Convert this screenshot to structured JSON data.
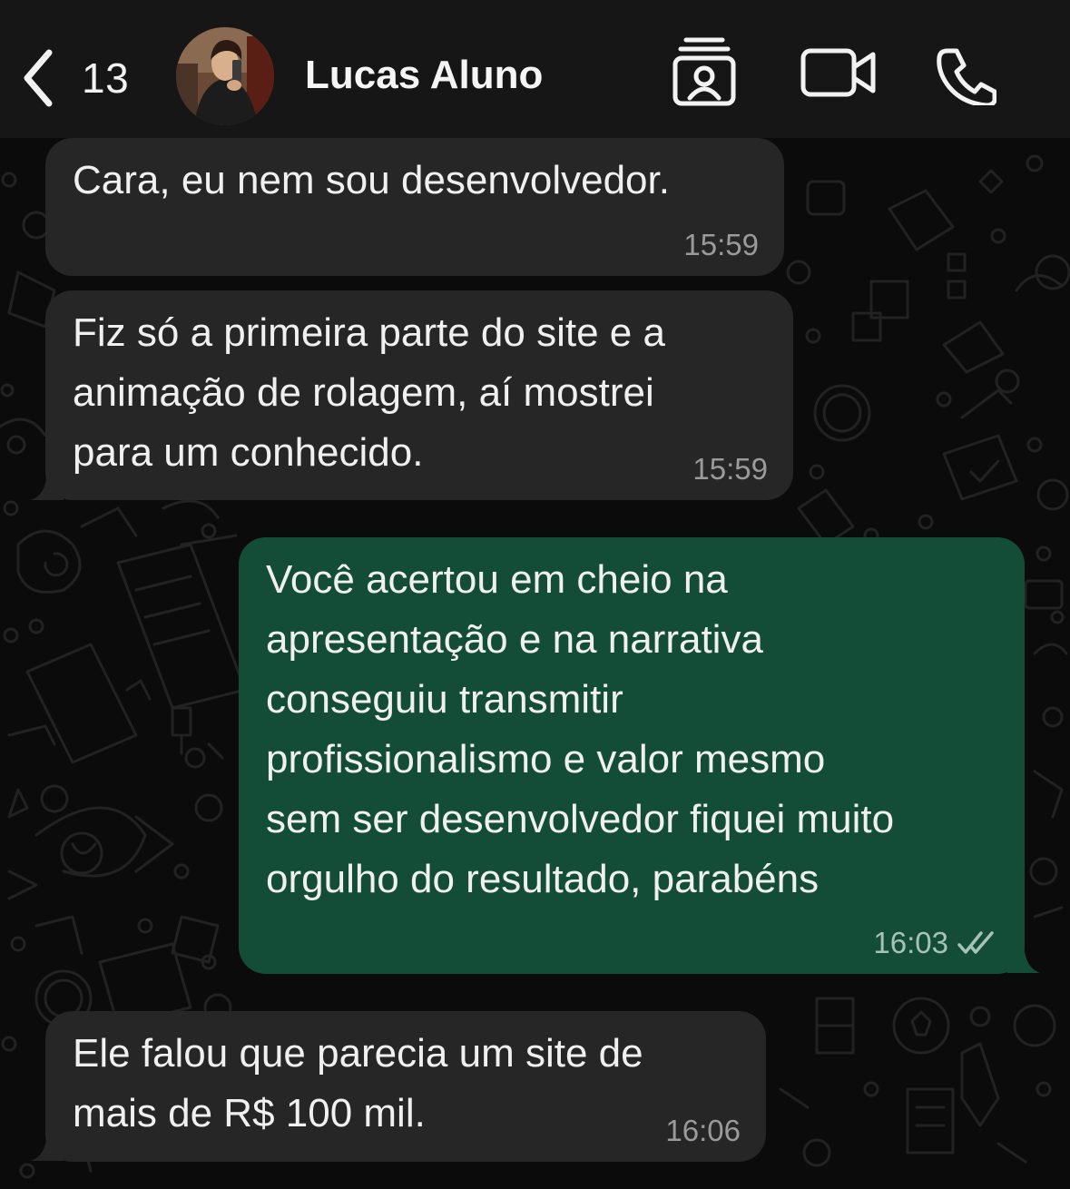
{
  "header": {
    "unread_count": "13",
    "contact_name": "Lucas Aluno",
    "icons": [
      "back-chevron-icon",
      "contact-card-icon",
      "video-camera-icon",
      "phone-icon"
    ]
  },
  "messages": [
    {
      "direction": "incoming",
      "text": "Cara, eu nem sou desenvolvedor.",
      "time": "15:59"
    },
    {
      "direction": "incoming",
      "text": "Fiz só a primeira parte do site e a\nanimação de rolagem, aí mostrei\npara um conhecido.",
      "time": "15:59"
    },
    {
      "direction": "outgoing",
      "text": "Você acertou em cheio na\napresentação e na narrativa\nconseguiu transmitir\nprofissionalismo e valor mesmo\nsem ser desenvolvedor fiquei muito\norgulho do resultado, parabéns",
      "time": "16:03",
      "status": "read-double-check-icon"
    },
    {
      "direction": "incoming",
      "text": "Ele falou que parecia um site de\nmais de R$ 100 mil.",
      "time": "16:06"
    }
  ],
  "colors": {
    "background": "#0b0b0b",
    "header": "#161616",
    "incoming_bubble": "#262626",
    "outgoing_bubble": "#144d37",
    "timestamp": "#9a9a9a"
  }
}
